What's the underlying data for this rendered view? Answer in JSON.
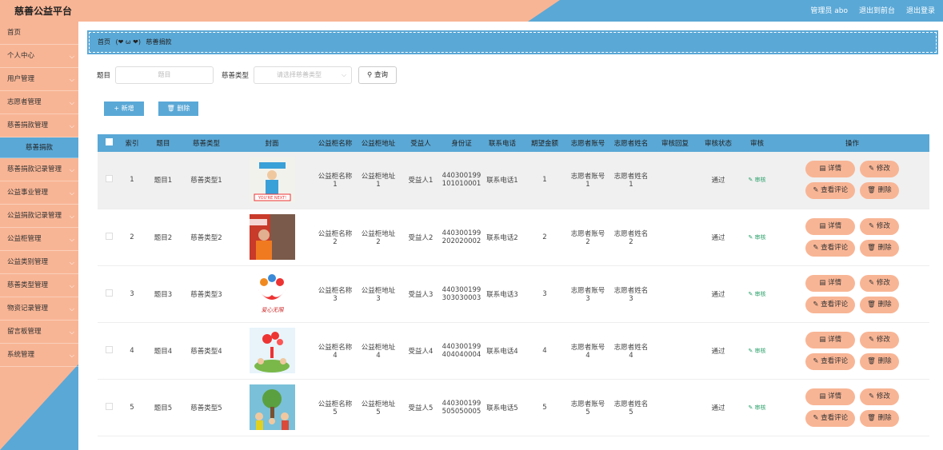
{
  "app": {
    "title": "慈善公益平台",
    "admin": "管理员 abo",
    "back": "退出到前台",
    "logout": "退出登录"
  },
  "sidebar": {
    "items": [
      {
        "label": "首页",
        "chev": false
      },
      {
        "label": "个人中心",
        "chev": true
      },
      {
        "label": "用户管理",
        "chev": true
      },
      {
        "label": "志愿者管理",
        "chev": true
      },
      {
        "label": "慈善捐款管理",
        "chev": true
      },
      {
        "label": "慈善捐款",
        "sub": true
      },
      {
        "label": "慈善捐款记录管理",
        "chev": true
      },
      {
        "label": "公益事业管理",
        "chev": true
      },
      {
        "label": "公益捐款记录管理",
        "chev": true
      },
      {
        "label": "公益柜管理",
        "chev": true
      },
      {
        "label": "公益类别管理",
        "chev": true
      },
      {
        "label": "慈善类型管理",
        "chev": true
      },
      {
        "label": "物资记录管理",
        "chev": true
      },
      {
        "label": "留言板管理",
        "chev": true
      },
      {
        "label": "系统管理",
        "chev": true
      }
    ]
  },
  "breadcrumb": {
    "home": "首页",
    "sep": "(❤ ω ❤)",
    "current": "慈善捐款"
  },
  "search": {
    "title_label": "题目",
    "title_placeholder": "题目",
    "type_label": "慈善类型",
    "type_placeholder": "请选择慈善类型",
    "query_button": "查询"
  },
  "toolbar": {
    "add": "+ 新增",
    "delete": "删除"
  },
  "table": {
    "headers": [
      "",
      "索引",
      "题目",
      "慈善类型",
      "封面",
      "公益柜名称",
      "公益柜地址",
      "受益人",
      "身份证",
      "联系电话",
      "期望金额",
      "志愿者账号",
      "志愿者姓名",
      "审核回复",
      "审核状态",
      "审核",
      "操作"
    ],
    "rows": [
      {
        "index": "1",
        "title": "题目1",
        "type": "慈善类型1",
        "cabinet_name": "公益柜名称\n1",
        "cabinet_addr": "公益柜地址\n1",
        "beneficiary": "受益人1",
        "id_card": "440300199\n101010001",
        "phone": "联系电话1",
        "amount": "1",
        "vol_account": "志愿者账号\n1",
        "vol_name": "志愿者姓名\n1",
        "reply": "",
        "status": "通过",
        "audit": "审核"
      },
      {
        "index": "2",
        "title": "题目2",
        "type": "慈善类型2",
        "cabinet_name": "公益柜名称\n2",
        "cabinet_addr": "公益柜地址\n2",
        "beneficiary": "受益人2",
        "id_card": "440300199\n202020002",
        "phone": "联系电话2",
        "amount": "2",
        "vol_account": "志愿者账号\n2",
        "vol_name": "志愿者姓名\n2",
        "reply": "",
        "status": "通过",
        "audit": "审核"
      },
      {
        "index": "3",
        "title": "题目3",
        "type": "慈善类型3",
        "cabinet_name": "公益柜名称\n3",
        "cabinet_addr": "公益柜地址\n3",
        "beneficiary": "受益人3",
        "id_card": "440300199\n303030003",
        "phone": "联系电话3",
        "amount": "3",
        "vol_account": "志愿者账号\n3",
        "vol_name": "志愿者姓名\n3",
        "reply": "",
        "status": "通过",
        "audit": "审核"
      },
      {
        "index": "4",
        "title": "题目4",
        "type": "慈善类型4",
        "cabinet_name": "公益柜名称\n4",
        "cabinet_addr": "公益柜地址\n4",
        "beneficiary": "受益人4",
        "id_card": "440300199\n404040004",
        "phone": "联系电话4",
        "amount": "4",
        "vol_account": "志愿者账号\n4",
        "vol_name": "志愿者姓名\n4",
        "reply": "",
        "status": "通过",
        "audit": "审核"
      },
      {
        "index": "5",
        "title": "题目5",
        "type": "慈善类型5",
        "cabinet_name": "公益柜名称\n5",
        "cabinet_addr": "公益柜地址\n5",
        "beneficiary": "受益人5",
        "id_card": "440300199\n505050005",
        "phone": "联系电话5",
        "amount": "5",
        "vol_account": "志愿者账号\n5",
        "vol_name": "志愿者姓名\n5",
        "reply": "",
        "status": "通过",
        "audit": "审核"
      }
    ],
    "ops": {
      "detail": "详情",
      "edit": "修改",
      "comment": "查看评论",
      "delete": "删除"
    }
  },
  "colors": {
    "blue": "#5aa8d6",
    "peach": "#f8b595"
  },
  "icons": {
    "audit": "edit-icon",
    "detail": "document-icon",
    "edit": "pencil-icon",
    "comment": "comment-icon",
    "delete": "trash-icon",
    "search": "search-icon"
  }
}
